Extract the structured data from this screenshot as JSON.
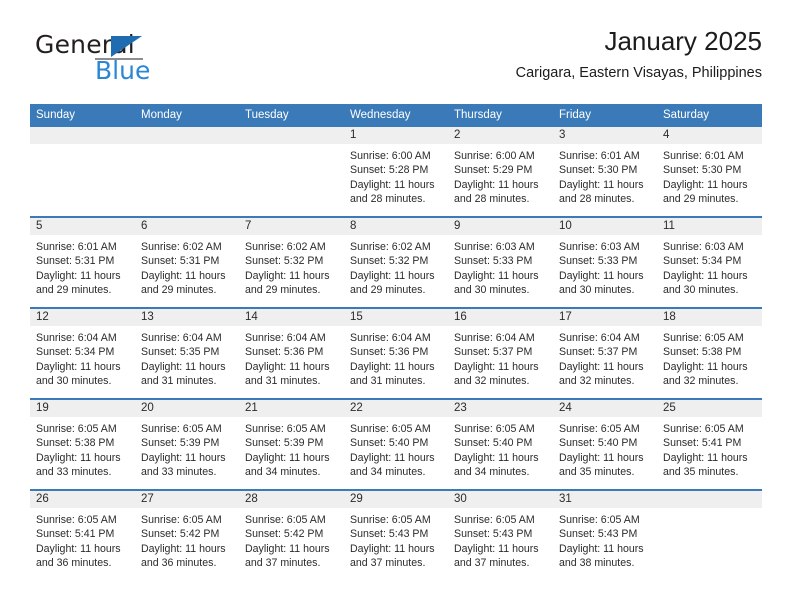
{
  "brand": {
    "word_one": "General",
    "word_two": "Blue",
    "triangle_icon": "blue-triangle-icon",
    "accent_blue": "#1f6cb0",
    "light_blue": "#2b87d3"
  },
  "header": {
    "title": "January 2025",
    "subtitle": "Carigara, Eastern Visayas, Philippines"
  },
  "colors": {
    "header_blue": "#3a7ab8",
    "daynum_band": "#efefef",
    "text": "#2b2b2b"
  },
  "calendar": {
    "weekday_headers": [
      "Sunday",
      "Monday",
      "Tuesday",
      "Wednesday",
      "Thursday",
      "Friday",
      "Saturday"
    ],
    "labels": {
      "sunrise": "Sunrise:",
      "sunset": "Sunset:",
      "daylight": "Daylight:"
    },
    "weeks": [
      [
        {
          "day": "",
          "empty": true
        },
        {
          "day": "",
          "empty": true
        },
        {
          "day": "",
          "empty": true
        },
        {
          "day": "1",
          "sunrise": "Sunrise: 6:00 AM",
          "sunset": "Sunset: 5:28 PM",
          "daylight": "Daylight: 11 hours and 28 minutes."
        },
        {
          "day": "2",
          "sunrise": "Sunrise: 6:00 AM",
          "sunset": "Sunset: 5:29 PM",
          "daylight": "Daylight: 11 hours and 28 minutes."
        },
        {
          "day": "3",
          "sunrise": "Sunrise: 6:01 AM",
          "sunset": "Sunset: 5:30 PM",
          "daylight": "Daylight: 11 hours and 28 minutes."
        },
        {
          "day": "4",
          "sunrise": "Sunrise: 6:01 AM",
          "sunset": "Sunset: 5:30 PM",
          "daylight": "Daylight: 11 hours and 29 minutes."
        }
      ],
      [
        {
          "day": "5",
          "sunrise": "Sunrise: 6:01 AM",
          "sunset": "Sunset: 5:31 PM",
          "daylight": "Daylight: 11 hours and 29 minutes."
        },
        {
          "day": "6",
          "sunrise": "Sunrise: 6:02 AM",
          "sunset": "Sunset: 5:31 PM",
          "daylight": "Daylight: 11 hours and 29 minutes."
        },
        {
          "day": "7",
          "sunrise": "Sunrise: 6:02 AM",
          "sunset": "Sunset: 5:32 PM",
          "daylight": "Daylight: 11 hours and 29 minutes."
        },
        {
          "day": "8",
          "sunrise": "Sunrise: 6:02 AM",
          "sunset": "Sunset: 5:32 PM",
          "daylight": "Daylight: 11 hours and 29 minutes."
        },
        {
          "day": "9",
          "sunrise": "Sunrise: 6:03 AM",
          "sunset": "Sunset: 5:33 PM",
          "daylight": "Daylight: 11 hours and 30 minutes."
        },
        {
          "day": "10",
          "sunrise": "Sunrise: 6:03 AM",
          "sunset": "Sunset: 5:33 PM",
          "daylight": "Daylight: 11 hours and 30 minutes."
        },
        {
          "day": "11",
          "sunrise": "Sunrise: 6:03 AM",
          "sunset": "Sunset: 5:34 PM",
          "daylight": "Daylight: 11 hours and 30 minutes."
        }
      ],
      [
        {
          "day": "12",
          "sunrise": "Sunrise: 6:04 AM",
          "sunset": "Sunset: 5:34 PM",
          "daylight": "Daylight: 11 hours and 30 minutes."
        },
        {
          "day": "13",
          "sunrise": "Sunrise: 6:04 AM",
          "sunset": "Sunset: 5:35 PM",
          "daylight": "Daylight: 11 hours and 31 minutes."
        },
        {
          "day": "14",
          "sunrise": "Sunrise: 6:04 AM",
          "sunset": "Sunset: 5:36 PM",
          "daylight": "Daylight: 11 hours and 31 minutes."
        },
        {
          "day": "15",
          "sunrise": "Sunrise: 6:04 AM",
          "sunset": "Sunset: 5:36 PM",
          "daylight": "Daylight: 11 hours and 31 minutes."
        },
        {
          "day": "16",
          "sunrise": "Sunrise: 6:04 AM",
          "sunset": "Sunset: 5:37 PM",
          "daylight": "Daylight: 11 hours and 32 minutes."
        },
        {
          "day": "17",
          "sunrise": "Sunrise: 6:04 AM",
          "sunset": "Sunset: 5:37 PM",
          "daylight": "Daylight: 11 hours and 32 minutes."
        },
        {
          "day": "18",
          "sunrise": "Sunrise: 6:05 AM",
          "sunset": "Sunset: 5:38 PM",
          "daylight": "Daylight: 11 hours and 32 minutes."
        }
      ],
      [
        {
          "day": "19",
          "sunrise": "Sunrise: 6:05 AM",
          "sunset": "Sunset: 5:38 PM",
          "daylight": "Daylight: 11 hours and 33 minutes."
        },
        {
          "day": "20",
          "sunrise": "Sunrise: 6:05 AM",
          "sunset": "Sunset: 5:39 PM",
          "daylight": "Daylight: 11 hours and 33 minutes."
        },
        {
          "day": "21",
          "sunrise": "Sunrise: 6:05 AM",
          "sunset": "Sunset: 5:39 PM",
          "daylight": "Daylight: 11 hours and 34 minutes."
        },
        {
          "day": "22",
          "sunrise": "Sunrise: 6:05 AM",
          "sunset": "Sunset: 5:40 PM",
          "daylight": "Daylight: 11 hours and 34 minutes."
        },
        {
          "day": "23",
          "sunrise": "Sunrise: 6:05 AM",
          "sunset": "Sunset: 5:40 PM",
          "daylight": "Daylight: 11 hours and 34 minutes."
        },
        {
          "day": "24",
          "sunrise": "Sunrise: 6:05 AM",
          "sunset": "Sunset: 5:40 PM",
          "daylight": "Daylight: 11 hours and 35 minutes."
        },
        {
          "day": "25",
          "sunrise": "Sunrise: 6:05 AM",
          "sunset": "Sunset: 5:41 PM",
          "daylight": "Daylight: 11 hours and 35 minutes."
        }
      ],
      [
        {
          "day": "26",
          "sunrise": "Sunrise: 6:05 AM",
          "sunset": "Sunset: 5:41 PM",
          "daylight": "Daylight: 11 hours and 36 minutes."
        },
        {
          "day": "27",
          "sunrise": "Sunrise: 6:05 AM",
          "sunset": "Sunset: 5:42 PM",
          "daylight": "Daylight: 11 hours and 36 minutes."
        },
        {
          "day": "28",
          "sunrise": "Sunrise: 6:05 AM",
          "sunset": "Sunset: 5:42 PM",
          "daylight": "Daylight: 11 hours and 37 minutes."
        },
        {
          "day": "29",
          "sunrise": "Sunrise: 6:05 AM",
          "sunset": "Sunset: 5:43 PM",
          "daylight": "Daylight: 11 hours and 37 minutes."
        },
        {
          "day": "30",
          "sunrise": "Sunrise: 6:05 AM",
          "sunset": "Sunset: 5:43 PM",
          "daylight": "Daylight: 11 hours and 37 minutes."
        },
        {
          "day": "31",
          "sunrise": "Sunrise: 6:05 AM",
          "sunset": "Sunset: 5:43 PM",
          "daylight": "Daylight: 11 hours and 38 minutes."
        },
        {
          "day": "",
          "empty": true
        }
      ]
    ]
  }
}
